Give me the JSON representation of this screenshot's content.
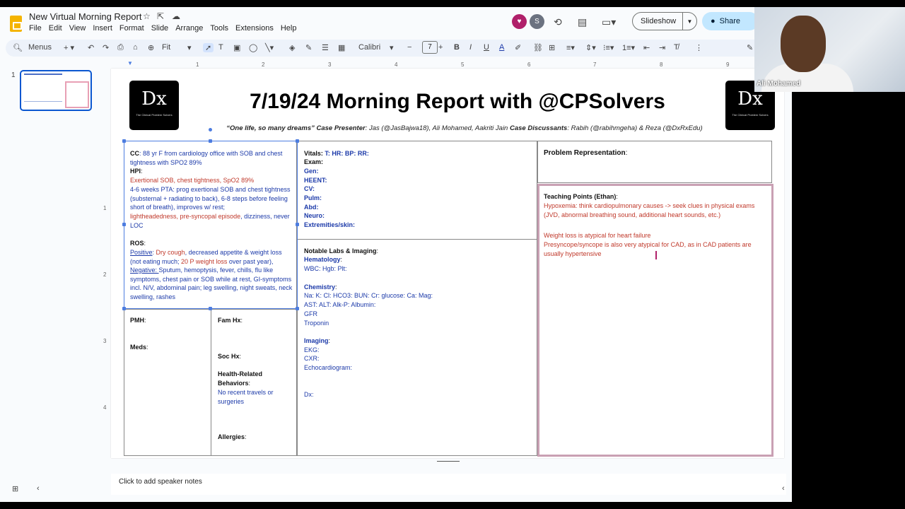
{
  "app": {
    "doc_title": "New Virtual Morning Report",
    "menu": [
      "File",
      "Edit",
      "View",
      "Insert",
      "Format",
      "Slide",
      "Arrange",
      "Tools",
      "Extensions",
      "Help"
    ],
    "avatar_s": "S",
    "slideshow_label": "Slideshow",
    "share_label": "Share",
    "toolbar": {
      "menus_label": "Menus",
      "zoom": "Fit",
      "font": "Calibri",
      "font_size": "7"
    },
    "ruler_h": [
      "1",
      "2",
      "3",
      "4",
      "5",
      "6",
      "7",
      "8",
      "9"
    ],
    "ruler_v": [
      "1",
      "2",
      "3",
      "4"
    ],
    "thumb_index": "1",
    "speaker_notes": "Click to add speaker notes"
  },
  "video": {
    "participant": "Ali Mohamed"
  },
  "slide": {
    "title": "7/19/24 Morning Report with @CPSolvers",
    "subtitle": {
      "quote": "“One life, so many dreams”",
      "presenter_label": "Case Presenter",
      "presenters": ": Jas (@JasBajwa18), Ali Mohamed, Aakriti Jain ",
      "discussants_label": "Case Discussants",
      "discussants": ": Rabih (@rabihmgeha) & Reza (@DxRxEdu)"
    },
    "logo": {
      "text": "Dx",
      "sub": "The Clinical Problem Solvers"
    },
    "cc": {
      "label": "CC",
      "text": ": 88 yr F from cardiology office with SOB and chest tightness with SPO2 89%"
    },
    "hpi": {
      "label": "HPI",
      "line1": "Exertional SOB, chest tightness, SpO2 89%",
      "line2": "4-6 weeks PTA:  prog exertional SOB and chest tightness (substernal + radiating to back), 6-8 steps before feeling short of breath), improves w/ rest;",
      "line3_red": "lightheadedness, pre-syncopal episode",
      "line3_blue": ", dizziness, never LOC"
    },
    "ros": {
      "label": "ROS",
      "positive_label": "Positive",
      "pos_a": ": ",
      "pos_b_red": "Dry cough",
      "pos_c": ", decreased appetite & weight loss (not eating much; ",
      "pos_d_red": "20 P weight loss",
      "pos_e": " over past year),",
      "negative_label": "Negative: ",
      "negative_text": "Sputum, hemoptysis, fever, chills, flu like symptoms, chest pain or SOB while at rest, GI-symptoms incl. N/V, abdominal pain; leg swelling, night sweats, neck swelling, rashes"
    },
    "pmh_label": "PMH",
    "meds_label": "Meds",
    "fam_label": "Fam Hx",
    "soc_label": "Soc Hx",
    "hrb_label": "Health-Related Behaviors",
    "hrb_text": "No recent travels or surgeries",
    "allergies_label": "Allergies",
    "vitals": {
      "label": "Vitals",
      "items": "T:  HR:  BP:  RR:",
      "exam": "Exam:",
      "gen": "Gen:",
      "heent": "HEENT:",
      "cv": "CV:",
      "pulm": "Pulm:",
      "abd": "Abd:",
      "neuro": "Neuro:",
      "ext": "Extremities/skin:"
    },
    "labs": {
      "label": "Notable Labs & Imaging",
      "heme_label": "Hematology",
      "heme": "WBC: Hgb: Plt:",
      "chem_label": "Chemistry",
      "chem1": "Na: K: Cl: HCO3: BUN: Cr: glucose: Ca: Mag:",
      "chem2": "AST:  ALT:  Alk-P: Albumin:",
      "gfr": "GFR",
      "trop": "Troponin",
      "img_label": "Imaging",
      "ekg": "EKG:",
      "cxr": "CXR:",
      "echo": "Echocardiogram:",
      "dx": "Dx:"
    },
    "problem_rep": "Problem Representation",
    "teaching": {
      "label": "Teaching Points (Ethan)",
      "p1": "Hypoxemia: think cardiopulmonary causes -> seek clues in physical exams (JVD, abnormal breathing sound, additional heart sounds, etc.)",
      "p2": "Weight loss is atypical for heart failure",
      "p3": "Presyncope/syncope is also very atypical for CAD, as in CAD patients are usually hypertensive"
    }
  }
}
